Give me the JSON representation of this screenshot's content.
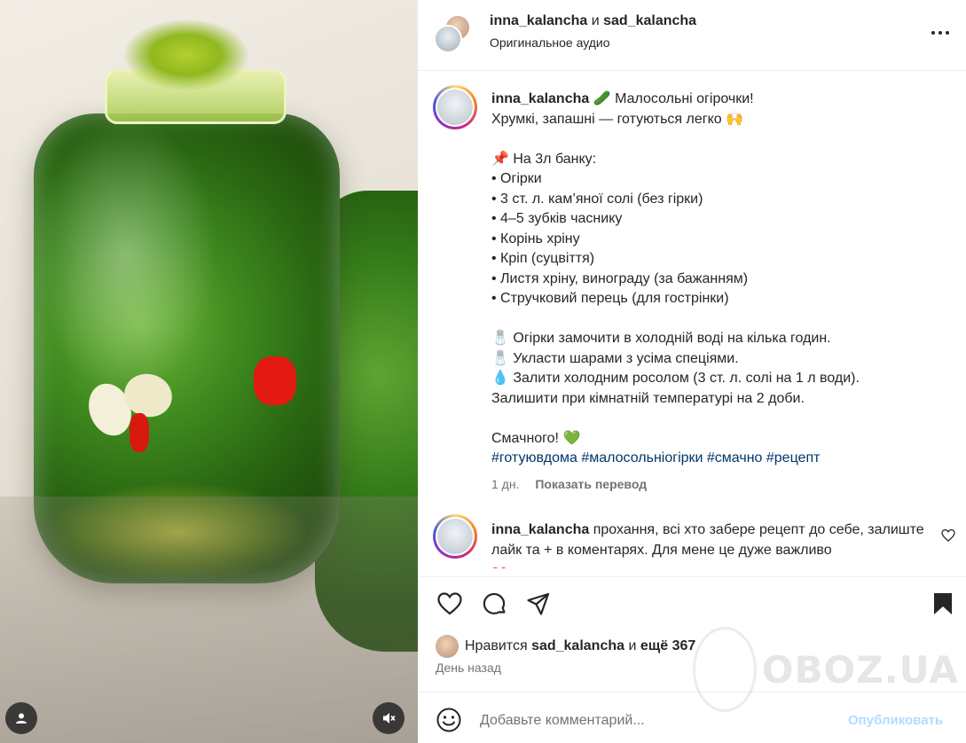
{
  "header": {
    "user1": "inna_kalancha",
    "conj": "и",
    "user2": "sad_kalancha",
    "audio": "Оригинальное аудио"
  },
  "caption": {
    "username": "inna_kalancha",
    "lines": [
      "🥒 Малосольні огірочки!",
      "Хрумкі, запашні — готуються легко 🙌",
      "",
      "📌 На 3л банку:",
      "• Огірки",
      "• 3 ст. л. кам’яної солі (без гірки)",
      "• 4–5 зубків часнику",
      "• Корінь хріну",
      "• Кріп (суцвіття)",
      "• Листя хріну, винограду (за бажанням)",
      "• Стручковий перець (для гострінки)",
      "",
      "🧂 Огірки замочити в холодній воді на кілька годин.",
      "🧂 Укласти шарами з усіма спеціями.",
      "💧 Залити холодним росолом (3 ст. л. солі на 1 л води).",
      "Залишити при кімнатній температурі на 2 доби.",
      "",
      "Смачного! 💚"
    ],
    "hashtags": "#готуювдома #малосольніогірки #смачно #рецепт",
    "time": "1 дн.",
    "translate": "Показать перевод"
  },
  "comment": {
    "username": "inna_kalancha",
    "text": "прохання, всі хто забере рецепт до себе, залиште лайк та + в коментарях. Для мене це дуже важливо"
  },
  "likes": {
    "prefix": "Нравится",
    "user": "sad_kalancha",
    "conj": "и",
    "rest": "ещё 367"
  },
  "date": "День назад",
  "add_comment": {
    "placeholder": "Добавьте комментарий...",
    "publish": "Опубликовать"
  },
  "watermark": "OBOZ.UA",
  "colors": {
    "link": "#00376b",
    "muted": "#737373",
    "publish": "#b3dbff",
    "text": "#262626"
  },
  "icons": [
    "user-tag-icon",
    "mute-icon",
    "more-icon",
    "heart-icon",
    "comment-icon",
    "share-icon",
    "bookmark-icon",
    "emoji-icon",
    "small-heart-icon"
  ]
}
